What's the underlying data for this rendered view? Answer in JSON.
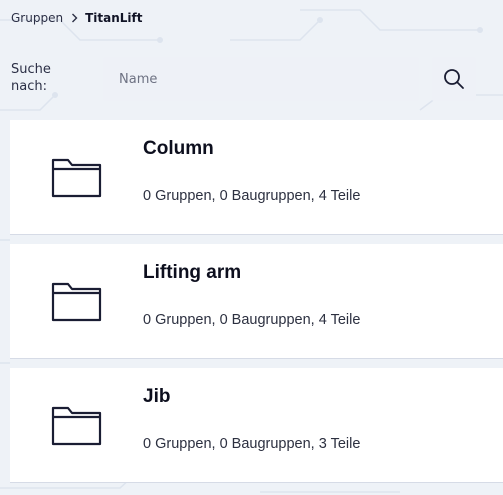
{
  "breadcrumb": {
    "parent": "Gruppen",
    "current": "TitanLift"
  },
  "search": {
    "label": "Suche nach:",
    "placeholder": "Name",
    "value": ""
  },
  "items": [
    {
      "title": "Column",
      "summary": "0 Gruppen, 0 Baugruppen, 4 Teile"
    },
    {
      "title": "Lifting arm",
      "summary": "0 Gruppen, 0 Baugruppen, 4 Teile"
    },
    {
      "title": "Jib",
      "summary": "0 Gruppen, 0 Baugruppen, 3 Teile"
    }
  ],
  "icons": {
    "separator": "chevron-right-icon",
    "search": "search-icon",
    "item": "folder-icon"
  },
  "colors": {
    "background": "#eef2f7",
    "card": "#ffffff",
    "text": "#1a1d33",
    "input": "#eef1f7"
  }
}
